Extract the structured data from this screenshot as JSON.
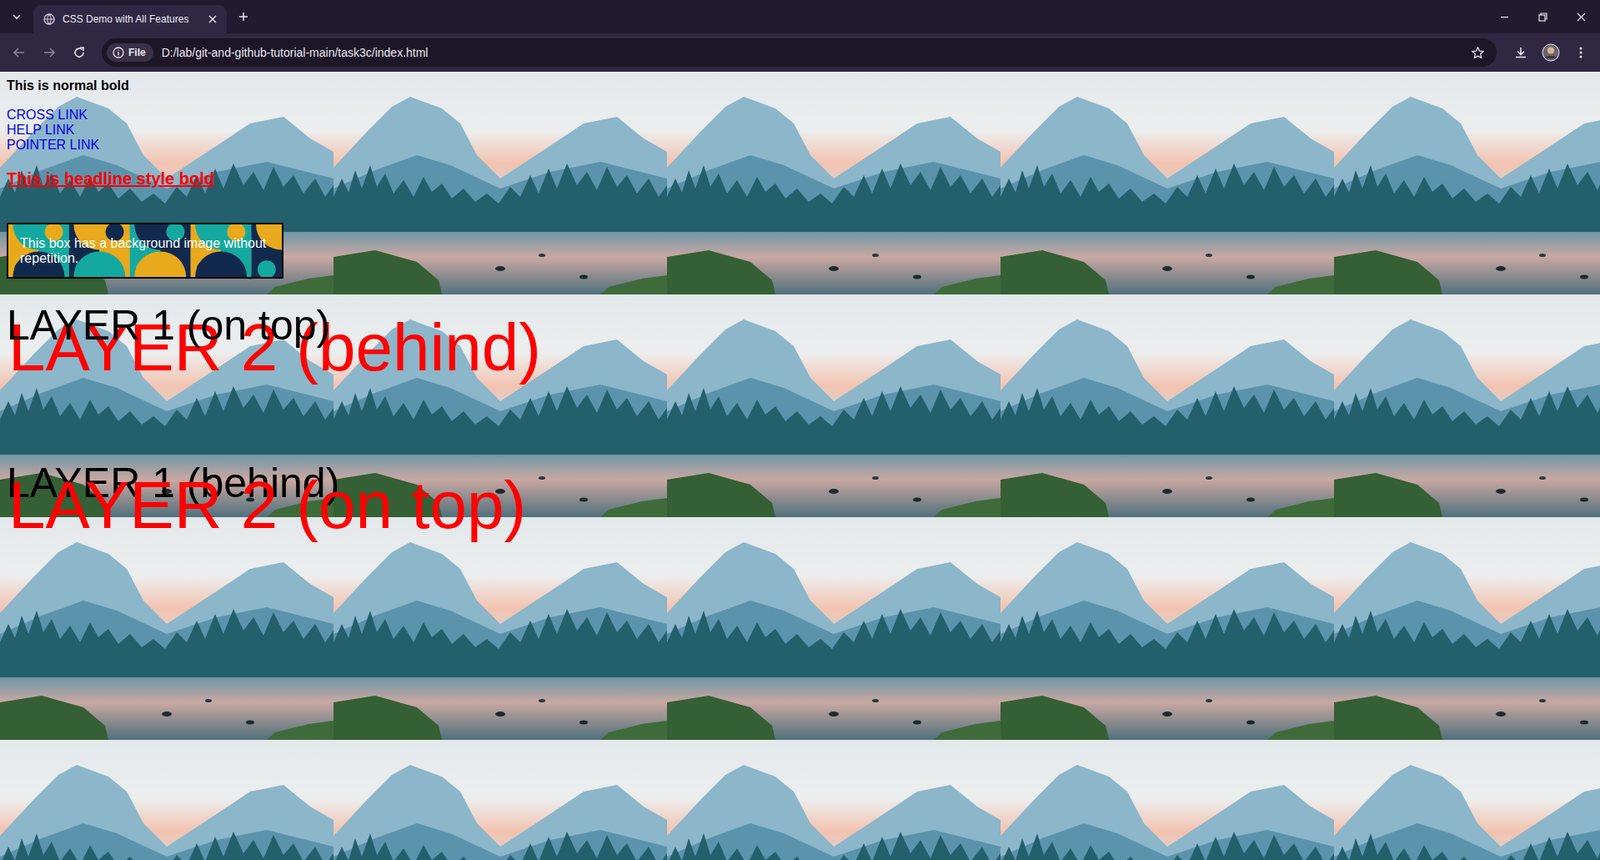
{
  "browser": {
    "tabs": [
      {
        "title": "CSS Demo with All Features",
        "selected": true
      }
    ],
    "address": {
      "chip": "File",
      "url": "D:/lab/git-and-github-tutorial-main/task3c/index.html"
    }
  },
  "page": {
    "normal_bold": "This is normal bold",
    "links": [
      "CROSS LINK",
      "HELP LINK",
      "POINTER LINK"
    ],
    "headline": "This is headline style bold",
    "box": {
      "text": "This box has a background image without repetition."
    },
    "layer_demos": [
      {
        "layers": [
          {
            "text": "LAYER 1 (on top)",
            "color": "#000000",
            "on_top": true
          },
          {
            "text": "LAYER 2 (behind)",
            "color": "#ff0000",
            "on_top": false
          }
        ]
      },
      {
        "layers": [
          {
            "text": "LAYER 1 (behind)",
            "color": "#000000",
            "on_top": false
          },
          {
            "text": "LAYER 2 (on top)",
            "color": "#ff0000",
            "on_top": true
          }
        ]
      }
    ]
  }
}
